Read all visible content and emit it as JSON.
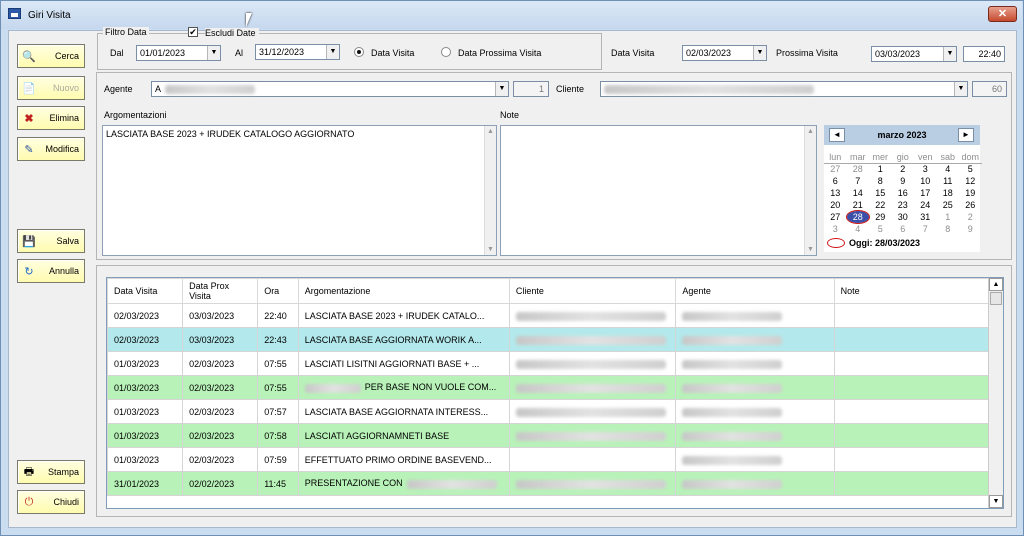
{
  "window": {
    "title": "Giri Visita",
    "close_glyph": "✕"
  },
  "sidebar": {
    "search": "Cerca",
    "new": "Nuovo",
    "delete": "Elimina",
    "edit": "Modifica",
    "save": "Salva",
    "cancel": "Annulla",
    "print": "Stampa",
    "close": "Chiudi"
  },
  "filter": {
    "legend": "Filtro Data",
    "exclude_dates": "Escludi Date",
    "exclude_checked": true,
    "from_label": "Dal",
    "from_value": "01/01/2023",
    "to_label": "Al",
    "to_value": "31/12/2023",
    "radio_visit": "Data Visita",
    "radio_next": "Data Prossima Visita",
    "selected": "visit"
  },
  "header": {
    "visit_date_label": "Data Visita",
    "visit_date_value": "02/03/2023",
    "next_visit_label": "Prossima Visita",
    "next_visit_value": "03/03/2023",
    "time_value": "22:40"
  },
  "agent": {
    "label": "Agente",
    "value": "A",
    "code": "1"
  },
  "client": {
    "label": "Cliente",
    "code": "60"
  },
  "notes": {
    "arg_label": "Argomentazioni",
    "arg_value": "LASCIATA BASE 2023 + IRUDEK CATALOGO AGGIORNATO",
    "note_label": "Note",
    "note_value": ""
  },
  "calendar": {
    "month": "marzo 2023",
    "prev": "◄",
    "next": "►",
    "dow": [
      "lun",
      "mar",
      "mer",
      "gio",
      "ven",
      "sab",
      "dom"
    ],
    "weeks": [
      [
        {
          "d": "27",
          "o": true
        },
        {
          "d": "28",
          "o": true
        },
        {
          "d": "1"
        },
        {
          "d": "2"
        },
        {
          "d": "3"
        },
        {
          "d": "4"
        },
        {
          "d": "5"
        }
      ],
      [
        {
          "d": "6"
        },
        {
          "d": "7"
        },
        {
          "d": "8"
        },
        {
          "d": "9"
        },
        {
          "d": "10"
        },
        {
          "d": "11"
        },
        {
          "d": "12"
        }
      ],
      [
        {
          "d": "13"
        },
        {
          "d": "14"
        },
        {
          "d": "15"
        },
        {
          "d": "16"
        },
        {
          "d": "17"
        },
        {
          "d": "18"
        },
        {
          "d": "19"
        }
      ],
      [
        {
          "d": "20"
        },
        {
          "d": "21"
        },
        {
          "d": "22"
        },
        {
          "d": "23"
        },
        {
          "d": "24"
        },
        {
          "d": "25"
        },
        {
          "d": "26"
        }
      ],
      [
        {
          "d": "27"
        },
        {
          "d": "28",
          "sel": true
        },
        {
          "d": "29"
        },
        {
          "d": "30"
        },
        {
          "d": "31"
        },
        {
          "d": "1",
          "o": true
        },
        {
          "d": "2",
          "o": true
        }
      ],
      [
        {
          "d": "3",
          "o": true
        },
        {
          "d": "4",
          "o": true
        },
        {
          "d": "5",
          "o": true
        },
        {
          "d": "6",
          "o": true
        },
        {
          "d": "7",
          "o": true
        },
        {
          "d": "8",
          "o": true
        },
        {
          "d": "9",
          "o": true
        }
      ]
    ],
    "today": "Oggi: 28/03/2023"
  },
  "grid": {
    "columns": [
      "Data Visita",
      "Data Prox Visita",
      "Ora",
      "Argomentazione",
      "Cliente",
      "Agente",
      "Note"
    ],
    "rows": [
      {
        "visit": "02/03/2023",
        "next": "03/03/2023",
        "time": "22:40",
        "arg": "LASCIATA BASE 2023 + IRUDEK CATALO...",
        "style": "white"
      },
      {
        "visit": "02/03/2023",
        "next": "03/03/2023",
        "time": "22:43",
        "arg": "LASCIATA BASE AGGIORNATA WORIK A...",
        "style": "alt"
      },
      {
        "visit": "01/03/2023",
        "next": "02/03/2023",
        "time": "07:55",
        "arg": "LASCIATI LISITNI AGGIORNATI BASE + ...",
        "style": "white"
      },
      {
        "visit": "01/03/2023",
        "next": "02/03/2023",
        "time": "07:55",
        "arg": "PER BASE NON VUOLE COM...",
        "style": "green",
        "argblur": true
      },
      {
        "visit": "01/03/2023",
        "next": "02/03/2023",
        "time": "07:57",
        "arg": "LASCIATA BASE AGGIORNATA INTERESS...",
        "style": "white"
      },
      {
        "visit": "01/03/2023",
        "next": "02/03/2023",
        "time": "07:58",
        "arg": "LASCIATI AGGIORNAMNETI BASE",
        "style": "green"
      },
      {
        "visit": "01/03/2023",
        "next": "02/03/2023",
        "time": "07:59",
        "arg": "EFFETTUATO PRIMO ORDINE BASEVEND...",
        "style": "white"
      },
      {
        "visit": "31/01/2023",
        "next": "02/02/2023",
        "time": "11:45",
        "arg": "PRESENTAZIONE CON",
        "style": "green",
        "argblurafter": true
      }
    ]
  },
  "scroll": {
    "up": "▲",
    "down": "▼",
    "dropdown": "▼"
  }
}
